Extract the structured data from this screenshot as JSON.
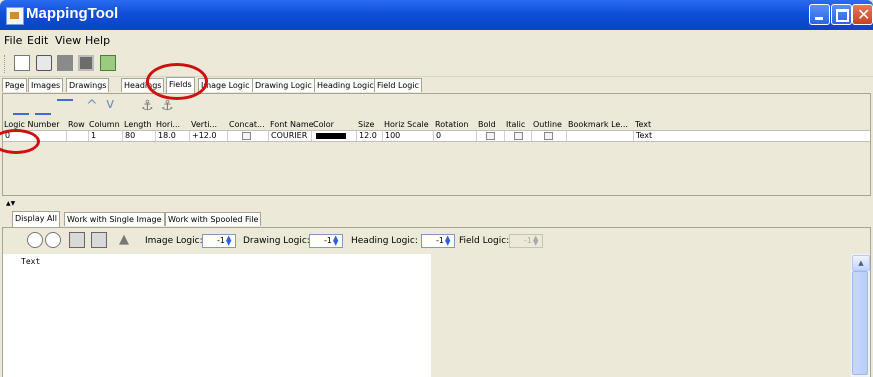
{
  "window": {
    "title": "MappingTool"
  },
  "menu": [
    "File",
    "Edit",
    "View",
    "Help"
  ],
  "top_tabs": [
    "Page",
    "Images",
    "Drawings",
    "Headings",
    "Fields",
    "Image Logic",
    "Drawing Logic",
    "Heading Logic",
    "Field Logic"
  ],
  "active_top_tab": "Fields",
  "table": {
    "columns": [
      "Logic Number",
      "Row",
      "Column",
      "Length",
      "Hori...",
      "Verti...",
      "Concat...",
      "Font Name",
      "Color",
      "Size",
      "Horiz Scale",
      "Rotation",
      "Bold",
      "Italic",
      "Outline",
      "Bookmark Le...",
      "Text"
    ],
    "rows": [
      {
        "logic_number": "0",
        "row": "",
        "column": "1",
        "length": "80",
        "hori": "18.0",
        "verti": "+12.0",
        "font_name": "COURIER",
        "color": "#000000",
        "size": "12.0",
        "horiz_scale": "100",
        "rotation": "0",
        "text": "Text"
      }
    ]
  },
  "bottom_tabs": [
    "Display All",
    "Work with Single Image",
    "Work with Spooled File"
  ],
  "active_bottom_tab": "Display All",
  "logic_controls": {
    "image_logic_label": "Image Logic:",
    "image_logic_value": "-1",
    "drawing_logic_label": "Drawing Logic:",
    "drawing_logic_value": "-1",
    "heading_logic_label": "Heading Logic:",
    "heading_logic_value": "-1",
    "field_logic_label": "Field Logic:",
    "field_logic_value": "-1"
  },
  "display_text": "Text",
  "accent_colors": {
    "annotation_circle": "#d01010",
    "title_bar": "#0f4fd8"
  }
}
